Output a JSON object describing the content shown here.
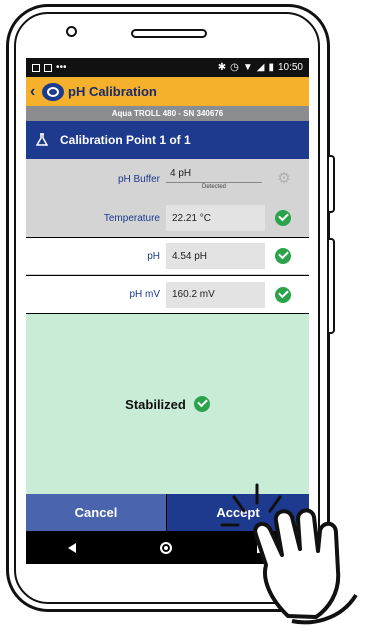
{
  "statusbar": {
    "time": "10:50"
  },
  "appbar": {
    "title": "pH Calibration",
    "back_icon": "chevron-left-icon"
  },
  "device": {
    "label": "Aqua TROLL 480 - SN 340676"
  },
  "cal_header": {
    "title": "Calibration Point 1 of 1"
  },
  "rows": {
    "buffer": {
      "label": "pH Buffer",
      "value": "4 pH",
      "note": "Detected"
    },
    "temperature": {
      "label": "Temperature",
      "value": "22.21 °C"
    },
    "ph": {
      "label": "pH",
      "value": "4.54 pH"
    },
    "ph_mv": {
      "label": "pH mV",
      "value": "160.2 mV"
    }
  },
  "status": {
    "text": "Stabilized"
  },
  "buttons": {
    "cancel": "Cancel",
    "accept": "Accept"
  },
  "colors": {
    "appbar": "#f5b12b",
    "primary": "#1d3a8f",
    "ok": "#2aa34a",
    "stable": "#c9ecd7"
  }
}
